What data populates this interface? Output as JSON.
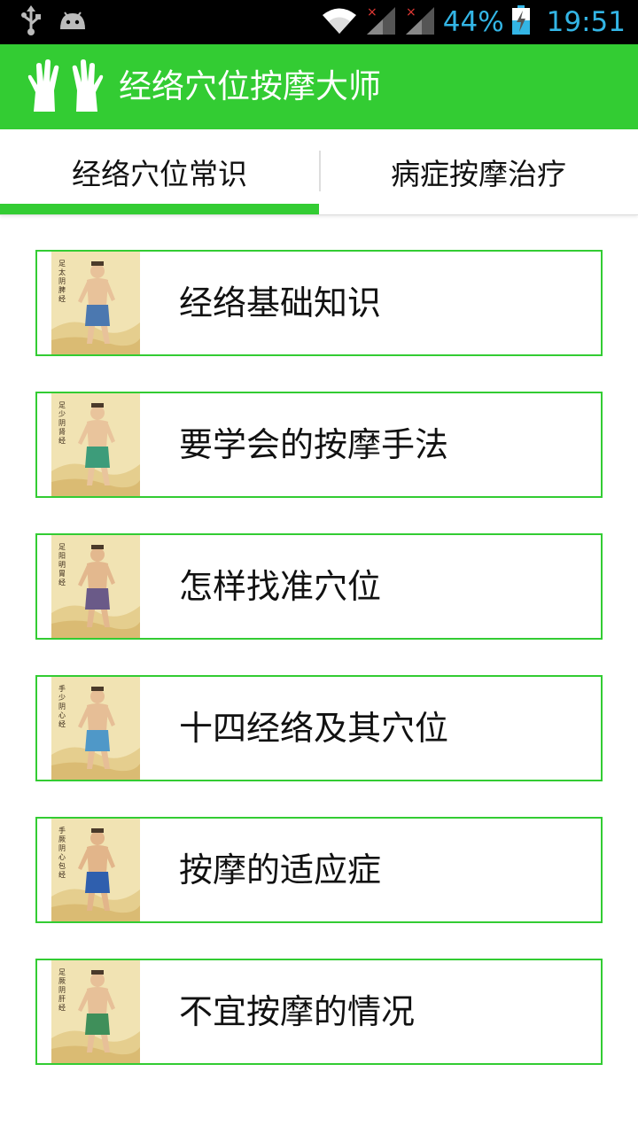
{
  "status_bar": {
    "battery_percent": "44%",
    "time": "19:51",
    "accent_color": "#33b5e5",
    "icons": [
      "usb-icon",
      "android-icon",
      "wifi-icon",
      "signal-icon",
      "signal-icon",
      "battery-charging-icon"
    ]
  },
  "action_bar": {
    "title": "经络穴位按摩大师",
    "background_color": "#33cc33",
    "logo_icon": "hands-icon"
  },
  "tabs": [
    {
      "label": "经络穴位常识",
      "selected": true
    },
    {
      "label": "病症按摩治疗",
      "selected": false
    }
  ],
  "items": [
    {
      "label": "经络基础知识",
      "thumb_caption": "足太阴脾经",
      "skin": "#e8c29a",
      "cloth": "#4b78b0"
    },
    {
      "label": "要学会的按摩手法",
      "thumb_caption": "足少阴肾经",
      "skin": "#e9c49c",
      "cloth": "#3d9c7a"
    },
    {
      "label": "怎样找准穴位",
      "thumb_caption": "足阳明胃经",
      "skin": "#e3b88e",
      "cloth": "#6a5a88"
    },
    {
      "label": "十四经络及其穴位",
      "thumb_caption": "手少阴心经",
      "skin": "#e6be96",
      "cloth": "#4f98c8"
    },
    {
      "label": "按摩的适应症",
      "thumb_caption": "手厥阴心包经",
      "skin": "#e2b58a",
      "cloth": "#2f5fae"
    },
    {
      "label": "不宜按摩的情况",
      "thumb_caption": "足厥阴肝经",
      "skin": "#e7c098",
      "cloth": "#3f8f5a"
    }
  ]
}
